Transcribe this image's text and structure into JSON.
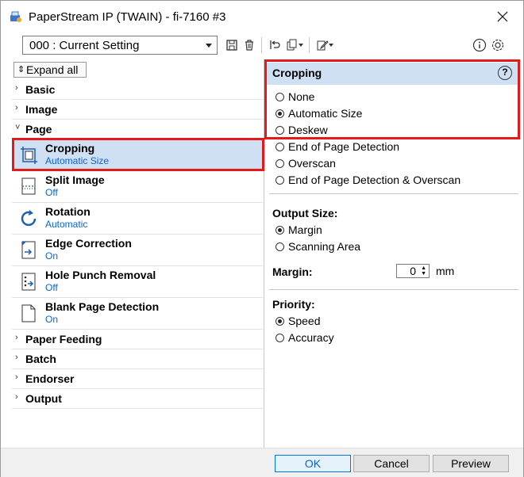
{
  "window": {
    "title": "PaperStream IP (TWAIN) - fi-7160 #3"
  },
  "toolbar": {
    "setting_value": "000 : Current Setting"
  },
  "left": {
    "expand_all": "Expand all",
    "sections_top": [
      {
        "label": "Basic"
      },
      {
        "label": "Image"
      },
      {
        "label": "Page"
      }
    ],
    "items": [
      {
        "name": "Cropping",
        "sub": "Automatic Size",
        "icon": "cropping-icon"
      },
      {
        "name": "Split Image",
        "sub": "Off",
        "icon": "split-image-icon"
      },
      {
        "name": "Rotation",
        "sub": "Automatic",
        "icon": "rotation-icon"
      },
      {
        "name": "Edge Correction",
        "sub": "On",
        "icon": "edge-correction-icon"
      },
      {
        "name": "Hole Punch Removal",
        "sub": "Off",
        "icon": "hole-punch-icon"
      },
      {
        "name": "Blank Page Detection",
        "sub": "On",
        "icon": "blank-page-icon"
      }
    ],
    "sections_bottom": [
      {
        "label": "Paper Feeding"
      },
      {
        "label": "Batch"
      },
      {
        "label": "Endorser"
      },
      {
        "label": "Output"
      }
    ]
  },
  "right": {
    "header": "Cropping",
    "cropping_options": [
      {
        "label": "None",
        "checked": false
      },
      {
        "label": "Automatic Size",
        "checked": true
      },
      {
        "label": "Deskew",
        "checked": false
      },
      {
        "label": "End of Page Detection",
        "checked": false
      },
      {
        "label": "Overscan",
        "checked": false
      },
      {
        "label": "End of Page Detection & Overscan",
        "checked": false
      }
    ],
    "output_size_label": "Output Size:",
    "output_size_options": [
      {
        "label": "Margin",
        "checked": true
      },
      {
        "label": "Scanning Area",
        "checked": false
      }
    ],
    "margin_label": "Margin:",
    "margin_value": "0",
    "margin_unit": "mm",
    "priority_label": "Priority:",
    "priority_options": [
      {
        "label": "Speed",
        "checked": true
      },
      {
        "label": "Accuracy",
        "checked": false
      }
    ]
  },
  "buttons": {
    "ok": "OK",
    "cancel": "Cancel",
    "preview": "Preview"
  },
  "colors": {
    "selection": "#cfe0f3",
    "highlight_box": "#e41a1a",
    "accent": "#0a64c8"
  }
}
